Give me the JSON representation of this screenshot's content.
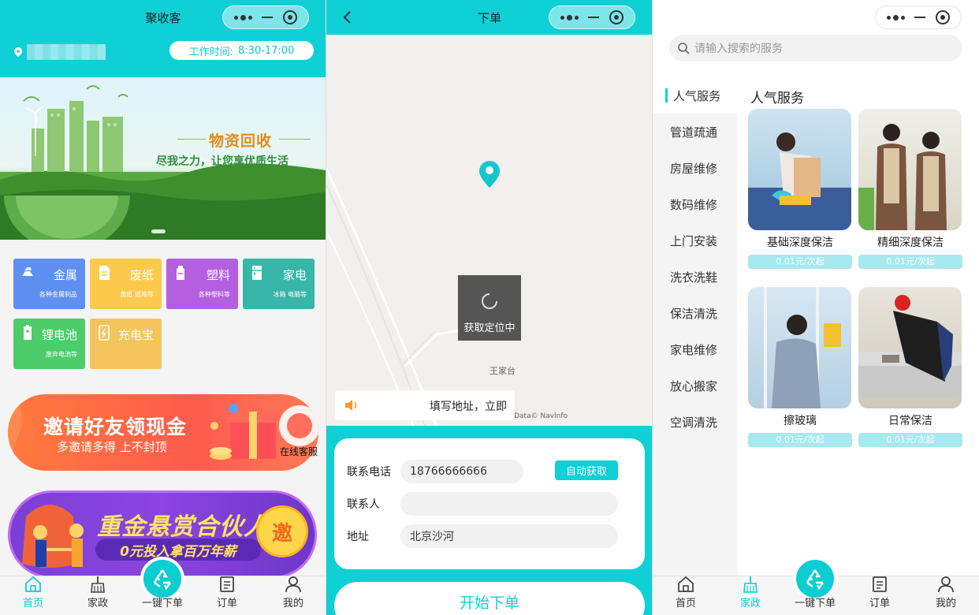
{
  "screen1": {
    "title": "聚收客",
    "work_time_label": "工作时间:",
    "work_time_value": "8:30-17:00",
    "banner": {
      "title": "物资回收",
      "subtitle": "尽我之力，让您享优质生活"
    },
    "categories": [
      {
        "name": "金属",
        "desc": "各种金属制品",
        "color": "#5f8ff0"
      },
      {
        "name": "废纸",
        "desc": "黄纸 纸箱等",
        "color": "#fbc94c"
      },
      {
        "name": "塑料",
        "desc": "各种塑料等",
        "color": "#b45fe0"
      },
      {
        "name": "家电",
        "desc": "冰箱 电脑等",
        "color": "#38b6a8"
      },
      {
        "name": "锂电池",
        "desc": "废弃电池等",
        "color": "#4ccc6b"
      },
      {
        "name": "充电宝",
        "desc": "",
        "color": "#f3c55c"
      }
    ],
    "invite": {
      "title": "邀请好友领现金",
      "subtitle": "多邀请多得 上不封顶"
    },
    "online_cs": "在线客服",
    "bounty": {
      "title": "重金悬赏合伙人",
      "subtitle": "0元投入拿百万年薪",
      "badge": "邀"
    }
  },
  "screen2": {
    "title": "下单",
    "loading": "获取定位中",
    "place": "王家台",
    "map_credit": "- Data© NavInfo",
    "notice": "填写地址，立即",
    "form": {
      "phone_label": "联系电话",
      "phone_value": "18766666666",
      "auto_label": "自动获取",
      "contact_label": "联系人",
      "contact_value": "",
      "address_label": "地址",
      "address_value": "北京沙河"
    },
    "start_label": "开始下单"
  },
  "screen3": {
    "search_placeholder": "请输入搜索的服务",
    "side": [
      "人气服务",
      "管道疏通",
      "房屋维修",
      "数码维修",
      "上门安装",
      "洗衣洗鞋",
      "保洁清洗",
      "家电维修",
      "放心搬家",
      "空调清洗"
    ],
    "section_title": "人气服务",
    "services": [
      {
        "name": "基础深度保洁",
        "price": "0.01元/次起"
      },
      {
        "name": "精细深度保洁",
        "price": "0.01元/次起"
      },
      {
        "name": "擦玻璃",
        "price": "0.01元/次起"
      },
      {
        "name": "日常保洁",
        "price": "0.01元/次起"
      }
    ]
  },
  "tabs": {
    "home": "首页",
    "housekeeping": "家政",
    "one_click": "一键下单",
    "orders": "订单",
    "mine": "我的"
  },
  "colors": {
    "accent": "#0fd0d5"
  }
}
